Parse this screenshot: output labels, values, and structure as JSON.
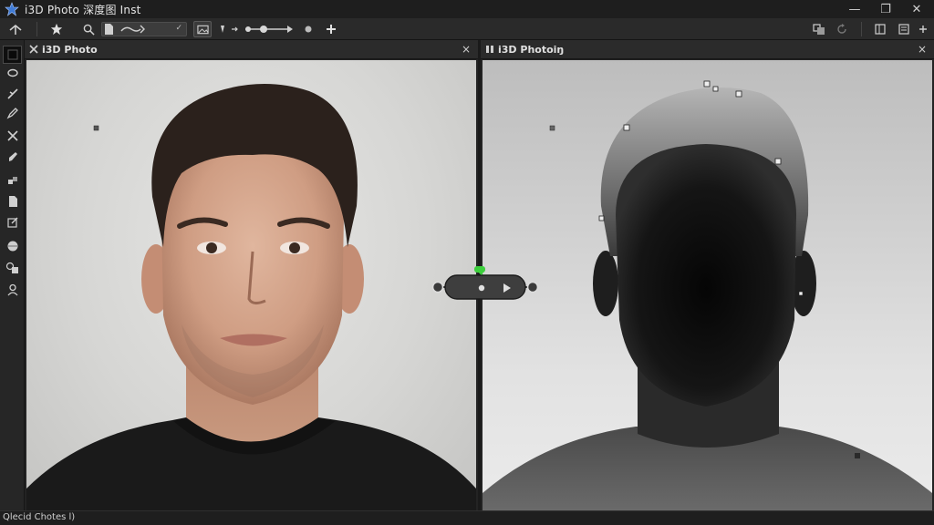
{
  "app": {
    "title": "i3D Photo 深度图 Inst",
    "logo_icon": "star-logo-icon"
  },
  "window_controls": {
    "minimize": "—",
    "maximize": "❐",
    "close": "✕"
  },
  "toolbar": {
    "icons": [
      "cursor-arrow-icon",
      "star-icon",
      "search-icon",
      "document-icon",
      "brush-icon",
      "image-icon",
      "filter-icon",
      "timeline-slider-icon",
      "add-icon",
      "layers-icon",
      "refresh-icon",
      "copy-icon",
      "settings-icon"
    ]
  },
  "tools": [
    "marquee-tool-icon",
    "lasso-tool-icon",
    "brush-tool-icon",
    "pen-tool-icon",
    "crop-tool-icon",
    "eraser-tool-icon",
    "fill-tool-icon",
    "document-tool-icon",
    "gradient-tool-icon",
    "sphere-tool-icon",
    "clone-tool-icon",
    "person-tool-icon"
  ],
  "left_panel": {
    "title": "i3D Photo",
    "close_label": "×"
  },
  "right_panel": {
    "title": "i3D Photoiŋ",
    "close_label": "×"
  },
  "status": {
    "text": "Qlecid Chotes l)"
  },
  "colors": {
    "accent_green": "#3ccf3c",
    "background": "#1b1b1b",
    "panel_header": "#2b2b2b"
  }
}
